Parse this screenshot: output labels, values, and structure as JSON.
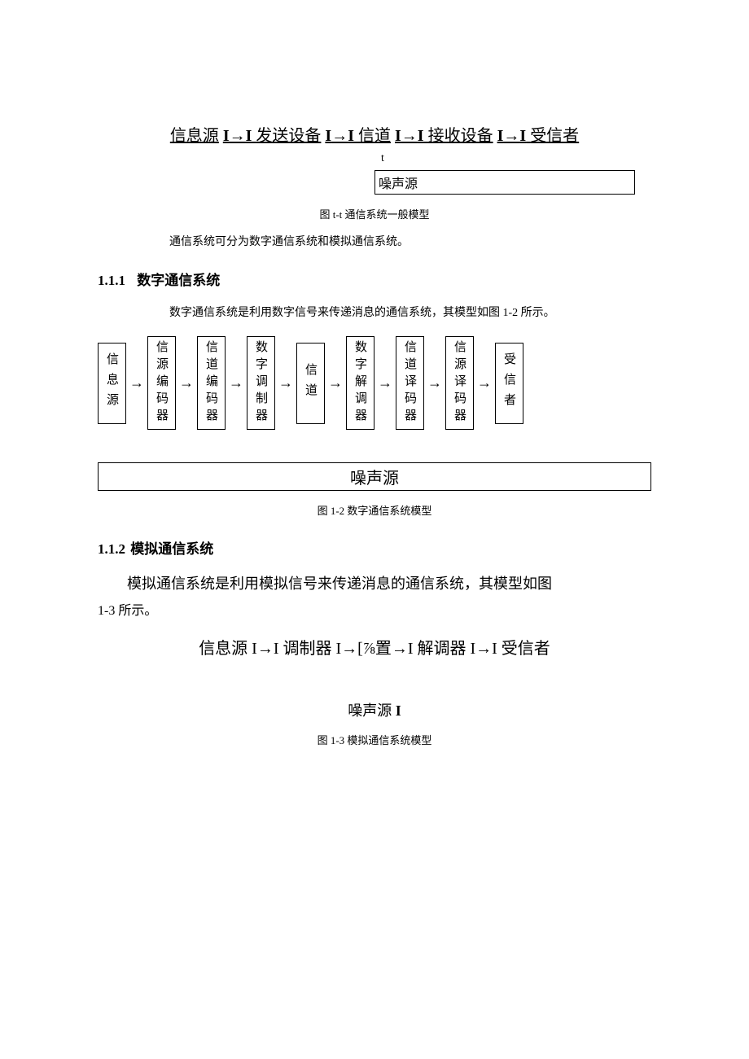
{
  "fig1": {
    "nodes": [
      "信息源",
      "发送设备",
      "信道",
      "接收设备",
      "受信者"
    ],
    "mark_i": "I",
    "arrow": "→",
    "t": "t",
    "noise": "噪声源",
    "caption": "图 t-t 通信系统一般模型"
  },
  "para1": "通信系统可分为数字通信系统和模拟通信系统。",
  "sec1": {
    "num": "1.1.1",
    "title": "数字通信系统"
  },
  "para2": "数字通信系统是利用数字信号来传递消息的通信系统，其模型如图 1-2 所示。",
  "fig2": {
    "boxes": [
      "信息源",
      "信源编码器",
      "信道编码器",
      "数字调制器",
      "信道",
      "数字解调器",
      "信道译码器",
      "信源译码器",
      "受信者"
    ],
    "arrow": "→",
    "noise": "噪声源",
    "caption": "图 1-2 数字通信系统模型"
  },
  "sec2": {
    "num": "1.1.2",
    "title": "模拟通信系统"
  },
  "para3a": "模拟通信系统是利用模拟信号来传递消息的通信系统，其模型如图",
  "para3b": "1-3 所示。",
  "fig3": {
    "line": "信息源 I→I 调制器 I→[⅞置→I 解调器 I→I 受信者",
    "noise": "噪声源",
    "mark_i": "I",
    "caption": "图 1-3 模拟通信系统模型"
  }
}
